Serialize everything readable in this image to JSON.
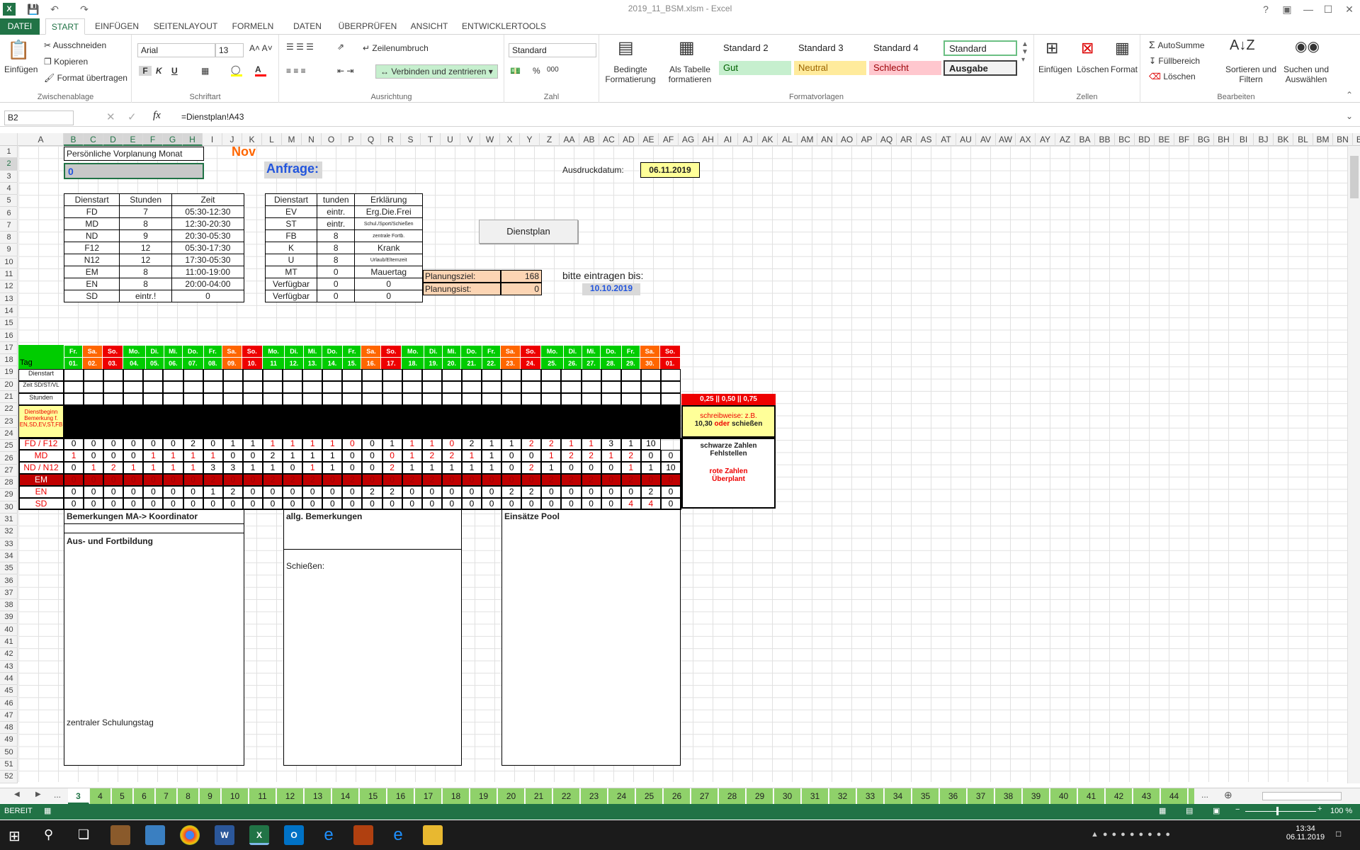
{
  "window": {
    "title": "2019_11_BSM.xlsm - Excel",
    "help": "?",
    "min": "—",
    "max": "☐",
    "close": "✕"
  },
  "ribbon_tabs": [
    "DATEI",
    "START",
    "EINFÜGEN",
    "SEITENLAYOUT",
    "FORMELN",
    "DATEN",
    "ÜBERPRÜFEN",
    "ANSICHT",
    "ENTWICKLERTOOLS"
  ],
  "clipboard": {
    "paste": "Einfügen",
    "cut": "Ausschneiden",
    "copy": "Kopieren",
    "format_painter": "Format übertragen",
    "label": "Zwischenablage"
  },
  "font": {
    "name": "Arial",
    "size": "13",
    "bold": "F",
    "italic": "K",
    "underline": "U",
    "label": "Schriftart"
  },
  "alignment": {
    "wrap": "Zeilenumbruch",
    "merge": "Verbinden und zentrieren",
    "label": "Ausrichtung"
  },
  "number": {
    "format": "Standard",
    "percent": "%",
    "thousands": "000",
    "label": "Zahl"
  },
  "styles": {
    "cond": "Bedingte Formatierung",
    "astable": "Als Tabelle formatieren",
    "s2": "Standard 2",
    "s3": "Standard 3",
    "s4": "Standard 4",
    "std": "Standard",
    "gut": "Gut",
    "neutral": "Neutral",
    "schlecht": "Schlecht",
    "ausgabe": "Ausgabe",
    "label": "Formatvorlagen",
    "c_gut": "#c6efce",
    "c_neutral": "#ffeb9c",
    "c_schlecht": "#ffc7ce"
  },
  "cells_grp": {
    "insert": "Einfügen",
    "delete": "Löschen",
    "format": "Format",
    "label": "Zellen"
  },
  "edit": {
    "autosum": "AutoSumme",
    "fill": "Füllbereich",
    "clear": "Löschen",
    "sort": "Sortieren und Filtern",
    "find": "Suchen und Auswählen",
    "label": "Bearbeiten"
  },
  "formula_bar": {
    "namebox": "B2",
    "formula": "=Dienstplan!A43",
    "fx": "fx"
  },
  "columns": [
    "A",
    "B",
    "C",
    "D",
    "E",
    "F",
    "G",
    "H",
    "I",
    "J",
    "K",
    "L",
    "M",
    "N",
    "O",
    "P",
    "Q",
    "R",
    "S",
    "T",
    "U",
    "V",
    "W",
    "X",
    "Y",
    "Z",
    "AA",
    "AB",
    "AC",
    "AD",
    "AE",
    "AF",
    "AG",
    "AH",
    "AI",
    "AJ",
    "AK",
    "AL",
    "AM",
    "AN",
    "AO",
    "AP",
    "AQ",
    "AR",
    "AS",
    "AT",
    "AU",
    "AV",
    "AW",
    "AX",
    "AY",
    "AZ",
    "BA",
    "BB",
    "BC",
    "BD",
    "BE",
    "BF",
    "BG",
    "BH",
    "BI",
    "BJ",
    "BK",
    "BL",
    "BM",
    "BN",
    "BO",
    "BF"
  ],
  "sheet": {
    "title": "Persönliche Vorplanung Monat",
    "month": "Nov",
    "b2": "0",
    "anfrage": "Anfrage:",
    "ausdruck_label": "Ausdruckdatum:",
    "ausdruck_date": "06.11.2019",
    "dienstplan_btn": "Dienstplan",
    "plan_ziel_label": "Planungsziel:",
    "plan_ziel": "168",
    "plan_ist_label": "Planungsist:",
    "plan_ist": "0",
    "bitte": "bitte eintragen bis:",
    "bitte_date": "10.10.2019",
    "shift_headers": [
      "Dienstart",
      "Stunden",
      "Zeit"
    ],
    "shifts": [
      [
        "FD",
        "7",
        "05:30-12:30"
      ],
      [
        "MD",
        "8",
        "12:30-20:30"
      ],
      [
        "ND",
        "9",
        "20:30-05:30"
      ],
      [
        "F12",
        "12",
        "05:30-17:30"
      ],
      [
        "N12",
        "12",
        "17:30-05:30"
      ],
      [
        "EM",
        "8",
        "11:00-19:00"
      ],
      [
        "EN",
        "8",
        "20:00-04:00"
      ],
      [
        "SD",
        "eintr.!",
        "0"
      ]
    ],
    "other_headers": [
      "Dienstart",
      "tunden",
      "Erklärung"
    ],
    "others": [
      [
        "EV",
        "eintr.",
        "Erg.Die.Frei"
      ],
      [
        "ST",
        "eintr.",
        "Schul./Sport/Schießen"
      ],
      [
        "FB",
        "8",
        "zentrale Fortb."
      ],
      [
        "K",
        "8",
        "Krank"
      ],
      [
        "U",
        "8",
        "Urlaub/Elternzeit"
      ],
      [
        "MT",
        "0",
        "Mauertag"
      ],
      [
        "Verfügbar",
        "0",
        "0"
      ],
      [
        "Verfügbar",
        "0",
        "0"
      ]
    ],
    "weekdays": [
      "Fr.",
      "Sa.",
      "So.",
      "Mo.",
      "Di.",
      "Mi.",
      "Do.",
      "Fr.",
      "Sa.",
      "So.",
      "Mo.",
      "Di.",
      "Mi.",
      "Do.",
      "Fr.",
      "Sa.",
      "So.",
      "Mo.",
      "Di.",
      "Mi.",
      "Do.",
      "Fr.",
      "Sa.",
      "So.",
      "Mo.",
      "Di.",
      "Mi.",
      "Do.",
      "Fr.",
      "Sa.",
      "So."
    ],
    "days": [
      "01.",
      "02.",
      "03.",
      "04.",
      "05.",
      "06.",
      "07.",
      "08.",
      "09.",
      "10.",
      "11",
      "12.",
      "13.",
      "14.",
      "15.",
      "16.",
      "17.",
      "18.",
      "19.",
      "20.",
      "21.",
      "22.",
      "23.",
      "24.",
      "25.",
      "26.",
      "27.",
      "28.",
      "29.",
      "30.",
      "01."
    ],
    "tag_label": "Tag",
    "row_labels": {
      "dienstart": "Dienstart",
      "zeit": "Zeit SD/ST/VL",
      "stunden": "Stunden",
      "beginn": "Dienstbeginn Bemerkung f. EN,SD,EV,ST,FB"
    },
    "counts": [
      {
        "label": "FD / F12",
        "vals": [
          "0",
          "0",
          "0",
          "0",
          "0",
          "0",
          "2",
          "0",
          "1",
          "1",
          "1",
          "1",
          "1",
          "1",
          "0",
          "0",
          "1",
          "1",
          "1",
          "0",
          "2",
          "1",
          "1",
          "2",
          "2",
          "1",
          "1",
          "3",
          "1",
          "10"
        ],
        "red": [
          10,
          11,
          12,
          13,
          14,
          17,
          18,
          19,
          23,
          24,
          25,
          26
        ]
      },
      {
        "label": "MD",
        "vals": [
          "1",
          "0",
          "0",
          "0",
          "1",
          "1",
          "1",
          "1",
          "0",
          "0",
          "2",
          "1",
          "1",
          "1",
          "0",
          "0",
          "0",
          "1",
          "2",
          "2",
          "1",
          "1",
          "0",
          "0",
          "1",
          "2",
          "2",
          "1",
          "2",
          "0",
          "0"
        ],
        "red": [
          0,
          4,
          5,
          6,
          7,
          16,
          17,
          18,
          19,
          20,
          24,
          25,
          26,
          27,
          28
        ]
      },
      {
        "label": "ND / N12",
        "vals": [
          "0",
          "1",
          "2",
          "1",
          "1",
          "1",
          "1",
          "3",
          "3",
          "1",
          "1",
          "0",
          "1",
          "1",
          "0",
          "0",
          "2",
          "1",
          "1",
          "1",
          "1",
          "1",
          "0",
          "2",
          "1",
          "0",
          "0",
          "0",
          "1",
          "1",
          "10"
        ],
        "red": [
          1,
          2,
          3,
          4,
          5,
          6,
          12,
          16,
          23,
          28
        ]
      },
      {
        "label": "EM",
        "vals": [
          "0",
          "0",
          "0",
          "0",
          "0",
          "0",
          "0",
          "2",
          "0",
          "0",
          "2",
          "2",
          "2",
          "0",
          "2",
          "0",
          "0",
          "2",
          "2",
          "0",
          "0",
          "0",
          "0",
          "0",
          "2",
          "2",
          "2",
          "0",
          "2",
          "0",
          "0"
        ],
        "red": []
      },
      {
        "label": "EN",
        "vals": [
          "0",
          "0",
          "0",
          "0",
          "0",
          "0",
          "0",
          "1",
          "2",
          "0",
          "0",
          "0",
          "0",
          "0",
          "0",
          "2",
          "2",
          "0",
          "0",
          "0",
          "0",
          "0",
          "2",
          "2",
          "0",
          "0",
          "0",
          "0",
          "0",
          "2",
          "0",
          "0"
        ],
        "red": []
      },
      {
        "label": "SD",
        "vals": [
          "0",
          "0",
          "0",
          "0",
          "0",
          "0",
          "0",
          "0",
          "0",
          "0",
          "0",
          "0",
          "0",
          "0",
          "0",
          "0",
          "0",
          "0",
          "0",
          "0",
          "0",
          "0",
          "0",
          "0",
          "0",
          "0",
          "0",
          "0",
          "4",
          "4",
          "0"
        ],
        "red": [
          28,
          29
        ]
      }
    ],
    "legend_top": "0,25 || 0,50 || 0,75",
    "legend_box1": "schreibweise: z.B.",
    "legend_box2": "10,30",
    "legend_box3": "oder",
    "legend_box4": "schießen",
    "legend_black1": "schwarze Zahlen",
    "legend_black2": "Fehlstellen",
    "legend_red1": "rote Zahlen",
    "legend_red2": "Überplant",
    "bem_koord": "Bemerkungen MA-> Koordinator",
    "aus_fort": "Aus- und Fortbildung",
    "zentral": "zentraler Schulungstag",
    "allg": "allg. Bemerkungen",
    "schiessen": "Schießen:",
    "pool": "Einsätze Pool"
  },
  "sheet_tabs": [
    "3",
    "4",
    "5",
    "6",
    "7",
    "8",
    "9",
    "10",
    "11",
    "12",
    "13",
    "14",
    "15",
    "16",
    "17",
    "18",
    "19",
    "20",
    "21",
    "22",
    "23",
    "24",
    "25",
    "26",
    "27",
    "28",
    "29",
    "30",
    "31",
    "32",
    "33",
    "34",
    "35",
    "36",
    "37",
    "38",
    "39",
    "40",
    "41",
    "42",
    "43",
    "44",
    "45"
  ],
  "status": {
    "ready": "BEREIT",
    "zoom": "100 %"
  },
  "taskbar": {
    "time": "13:34",
    "date": "06.11.2019"
  },
  "colors": {
    "excel_green": "#217346",
    "weekday_green": "#00cc00",
    "sat_orange": "#ff6600",
    "sun_red": "#ee0000",
    "em_red": "#c00000"
  }
}
